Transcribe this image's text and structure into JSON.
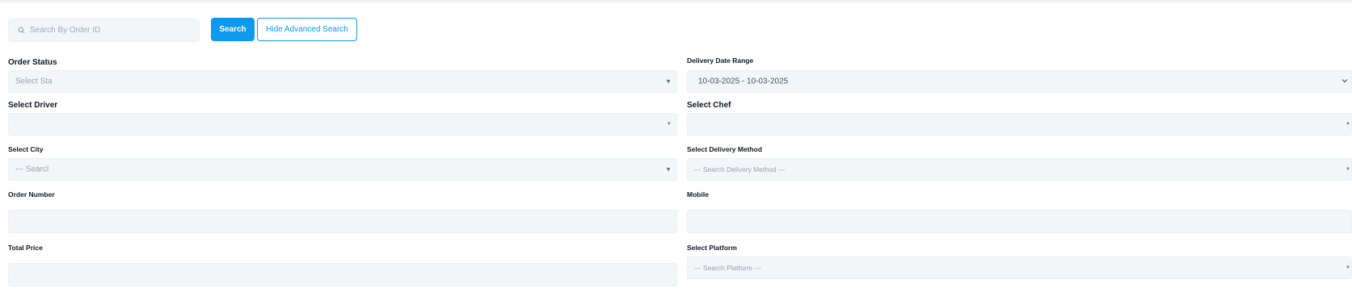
{
  "search": {
    "placeholder": "Search By Order ID",
    "search_label": "Search",
    "hide_advanced_label": "Hide Advanced Search"
  },
  "filters": {
    "order_status": {
      "label": "Order Status",
      "placeholder": "Select Sta"
    },
    "delivery_date_range": {
      "label": "Delivery Date Range",
      "value": "10-03-2025 - 10-03-2025"
    },
    "driver": {
      "label": "Select Driver",
      "value": ""
    },
    "chef": {
      "label": "Select Chef",
      "value": ""
    },
    "city": {
      "label": "Select City",
      "placeholder": "--- Searcl"
    },
    "delivery_method": {
      "label": "Select Delivery Method",
      "placeholder": "--- Search Delivery Method ---"
    },
    "order_number": {
      "label": "Order Number",
      "value": ""
    },
    "mobile": {
      "label": "Mobile",
      "value": ""
    },
    "total_price": {
      "label": "Total Price",
      "value": ""
    },
    "platform": {
      "label": "Select Platform",
      "placeholder": "--- Search Platform ---"
    }
  },
  "icons": {
    "search": "search-icon",
    "dropdown_caret": "caret-down-icon",
    "chevron": "chevron-down-icon"
  },
  "colors": {
    "accent": "#0d99ee",
    "field_bg": "#f3f5f8",
    "placeholder": "#9aa3ae"
  }
}
